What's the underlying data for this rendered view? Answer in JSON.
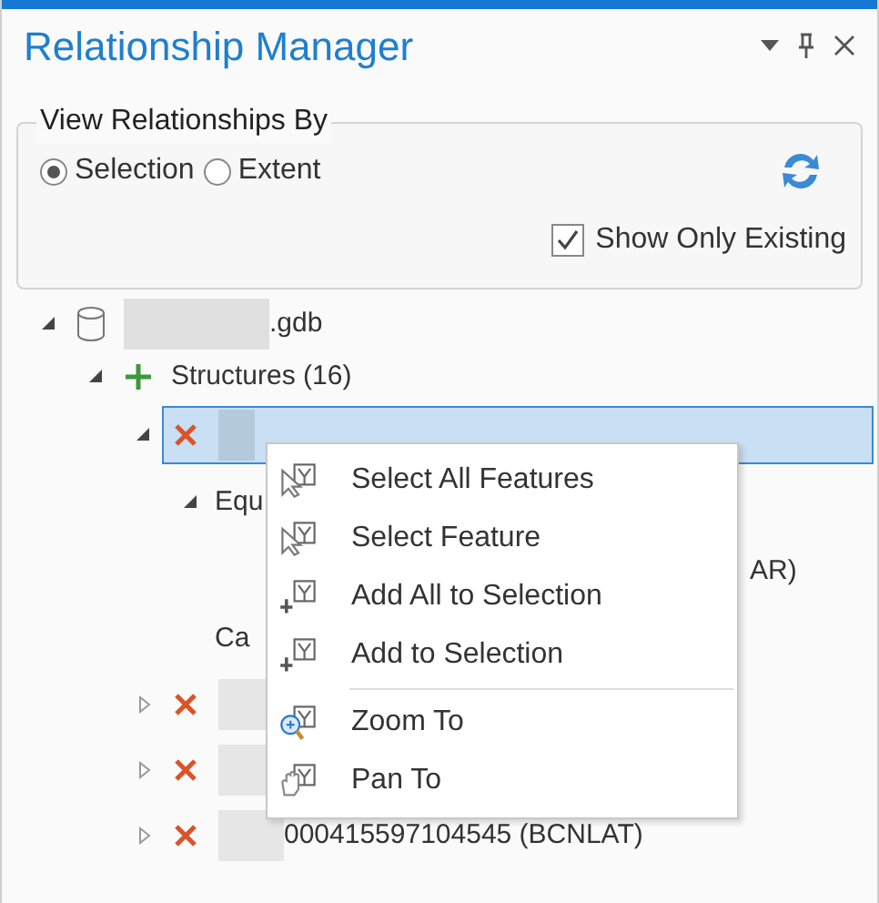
{
  "pane": {
    "title": "Relationship Manager"
  },
  "view_by": {
    "legend": "View Relationships By",
    "options": [
      {
        "label": "Selection",
        "selected": true
      },
      {
        "label": "Extent",
        "selected": false
      }
    ],
    "show_only_existing": {
      "label": "Show Only Existing",
      "checked": true
    }
  },
  "tree": [
    {
      "label": ".gdb",
      "kind": "database",
      "masked": true,
      "expanded": true,
      "selected": false,
      "children": [
        {
          "label": "Structures (16)",
          "kind": "add",
          "expanded": true,
          "selected": false,
          "children": [
            {
              "kind": "delete",
              "masked": true,
              "expanded": true,
              "selected": true,
              "children": [
                {
                  "label": "Equ",
                  "kind": "plain",
                  "expanded": true,
                  "selected": false,
                  "children": [
                    {
                      "label": "AR)",
                      "kind": "covered",
                      "selected": false
                    }
                  ]
                },
                {
                  "label": "Ca",
                  "kind": "plain",
                  "selected": false
                }
              ]
            },
            {
              "kind": "delete",
              "masked": true,
              "expanded": false,
              "selected": false
            },
            {
              "kind": "delete",
              "masked": true,
              "expanded": false,
              "selected": false
            },
            {
              "label": "000415597104545 (BCNLAT)",
              "kind": "delete",
              "masked": true,
              "expanded": false,
              "selected": false
            }
          ]
        }
      ]
    }
  ],
  "context_menu": [
    {
      "label": "Select All Features",
      "kind": "select",
      "separator_before": false
    },
    {
      "label": "Select Feature",
      "kind": "select",
      "separator_before": false
    },
    {
      "label": "Add All to Selection",
      "kind": "add",
      "separator_before": false
    },
    {
      "label": "Add to Selection",
      "kind": "add",
      "separator_before": false
    },
    {
      "label": "Zoom To",
      "kind": "zoom",
      "separator_before": true
    },
    {
      "label": "Pan To",
      "kind": "pan",
      "separator_before": false
    }
  ]
}
